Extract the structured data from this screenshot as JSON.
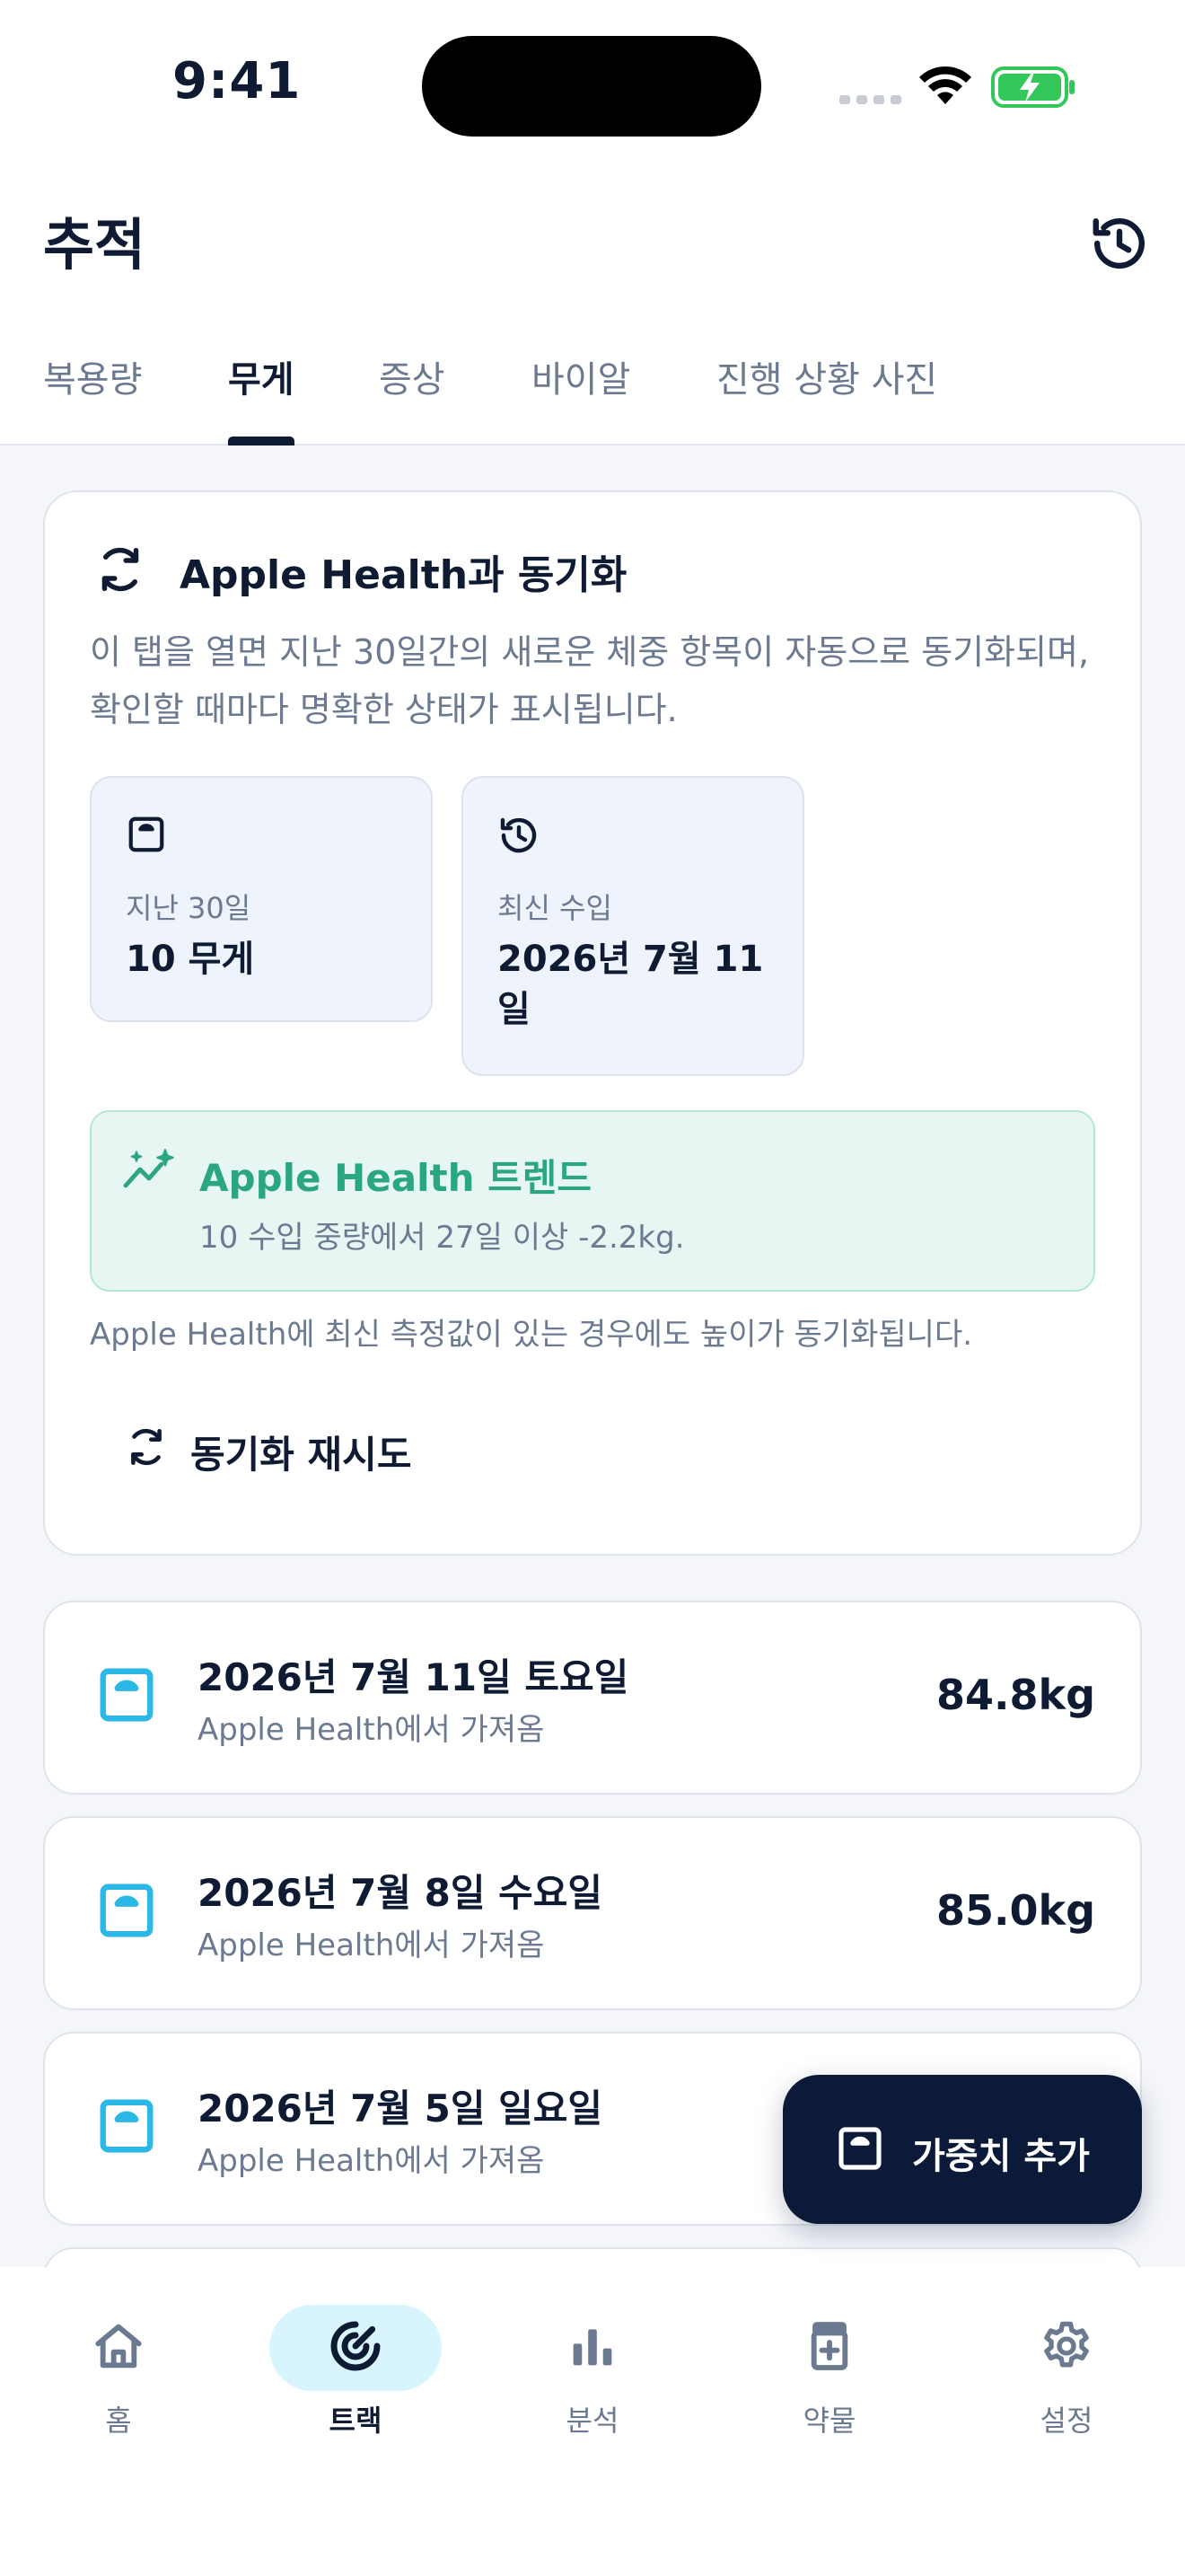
{
  "status_bar": {
    "time": "9:41"
  },
  "header": {
    "title": "추적"
  },
  "tabs": [
    {
      "label": "복용량"
    },
    {
      "label": "무게",
      "active": true
    },
    {
      "label": "증상"
    },
    {
      "label": "바이알"
    },
    {
      "label": "진행 상황 사진"
    }
  ],
  "sync_card": {
    "title": "Apple Health과 동기화",
    "description": "이 탭을 열면 지난 30일간의 새로운 체중 항목이 자동으로 동기화되며, 확인할 때마다 명확한 상태가 표시됩니다.",
    "stats": [
      {
        "label": "지난 30일",
        "value": "10 무게",
        "icon": "scale-icon"
      },
      {
        "label": "최신 수입",
        "value": "2026년 7월 11일",
        "icon": "history-icon"
      }
    ],
    "trend": {
      "title": "Apple Health 트렌드",
      "body": "10 수입 중량에서 27일 이상 -2.2kg."
    },
    "height_note": "Apple Health에 최신 측정값이 있는 경우에도 높이가 동기화됩니다.",
    "retry_label": "동기화 재시도"
  },
  "entries": [
    {
      "date": "2026년 7월 11일 토요일",
      "source": "Apple Health에서 가져옴",
      "value": "84.8kg"
    },
    {
      "date": "2026년 7월 8일 수요일",
      "source": "Apple Health에서 가져옴",
      "value": "85.0kg"
    },
    {
      "date": "2026년 7월 5일 일요일",
      "source": "Apple Health에서 가져옴",
      "value": ""
    }
  ],
  "fab": {
    "label": "가중치 추가"
  },
  "bottom_nav": [
    {
      "label": "홈",
      "icon": "home-icon"
    },
    {
      "label": "트랙",
      "icon": "track-icon",
      "active": true
    },
    {
      "label": "분석",
      "icon": "chart-icon"
    },
    {
      "label": "약물",
      "icon": "medication-icon"
    },
    {
      "label": "설정",
      "icon": "gear-icon"
    }
  ],
  "colors": {
    "accent_dark": "#0B1A38",
    "trend_green": "#2AA683",
    "entry_icon_blue": "#2BB7E8",
    "nav_active_bg": "#D8F4FC"
  }
}
